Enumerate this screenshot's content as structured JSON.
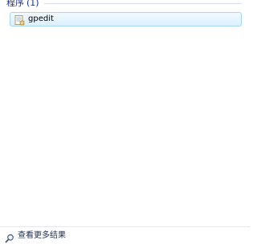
{
  "results": {
    "group": {
      "title": "程序",
      "count": "(1)"
    },
    "items": [
      {
        "label": "gpedit",
        "icon": "policy-editor-icon"
      }
    ]
  },
  "footer": {
    "more_results_label": "查看更多结果",
    "icon": "search-icon"
  },
  "colors": {
    "group_title": "#1e3287",
    "selection_border": "#a8d8f0",
    "selection_fill": "#dcefff"
  }
}
